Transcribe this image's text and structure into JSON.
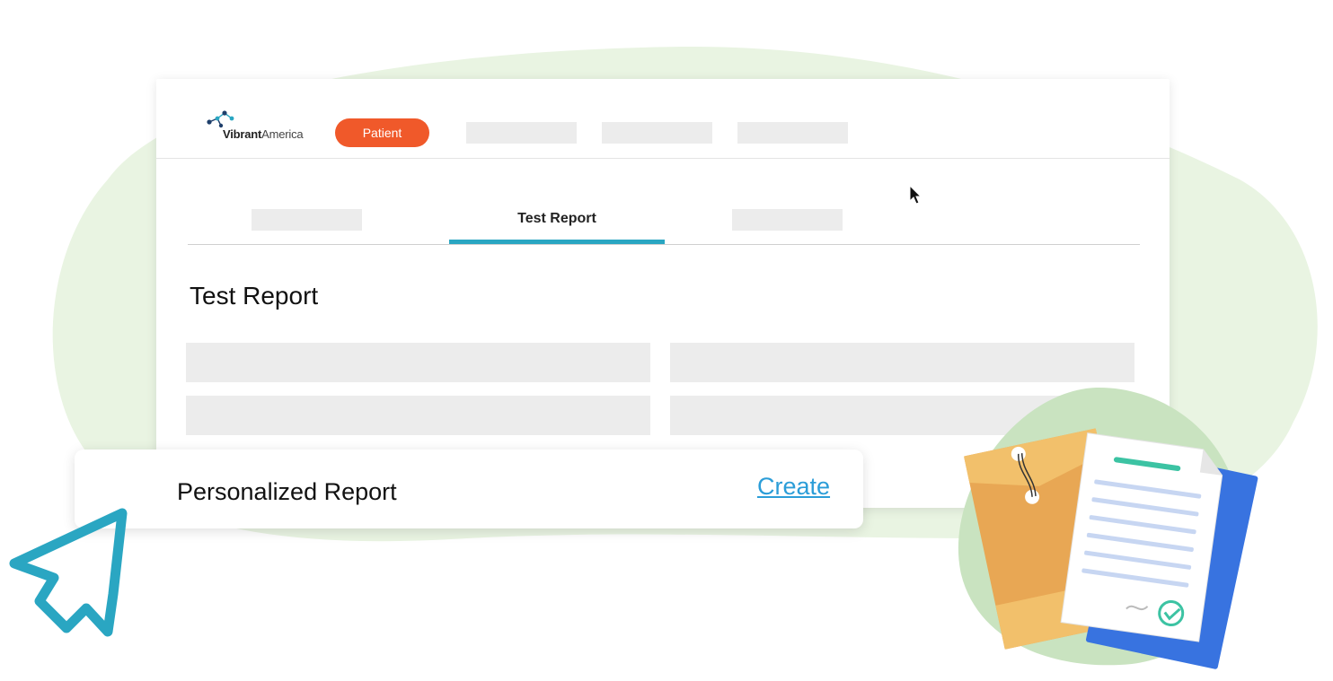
{
  "logo": {
    "brand_bold": "Vibrant",
    "brand_light": "America"
  },
  "header": {
    "active_nav_label": "Patient"
  },
  "tabs": {
    "active_label": "Test Report"
  },
  "section": {
    "title": "Test Report"
  },
  "action_card": {
    "label": "Personalized Report",
    "link_label": "Create"
  },
  "colors": {
    "accent_orange": "#f0592a",
    "tab_underline": "#2aa6c2",
    "link_blue": "#2b9dd8",
    "background_blob": "#e9f4e2",
    "cursor_teal": "#2aa6c2"
  },
  "icons": [
    "logo-molecule-icon",
    "mouse-pointer-icon",
    "big-cursor-icon",
    "documents-illustration-icon"
  ]
}
